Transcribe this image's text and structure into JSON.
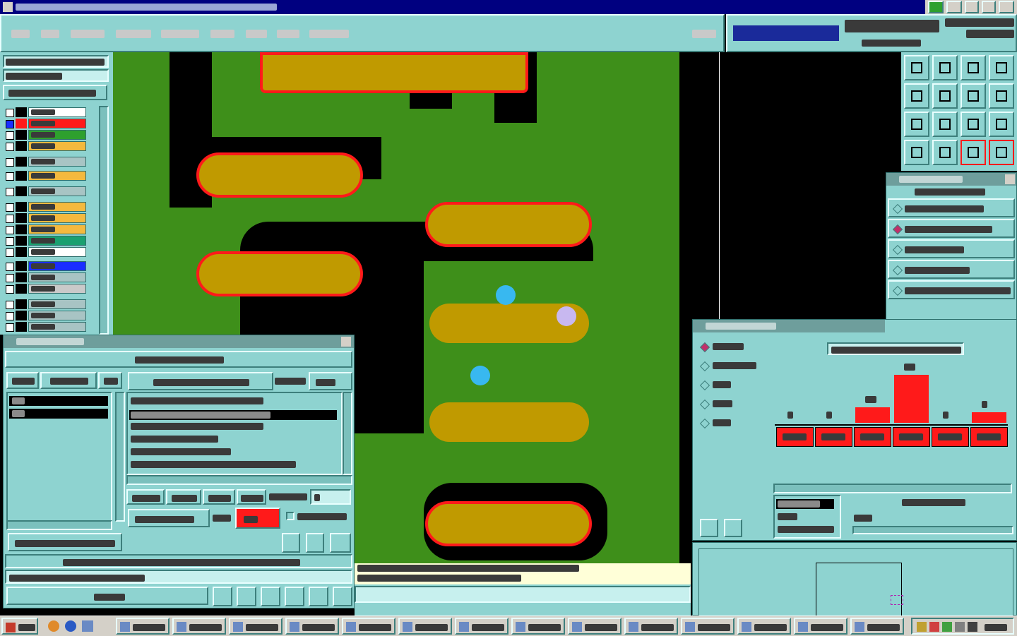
{
  "colors": {
    "window_bg": "#8ed3d0",
    "pcb_green": "#3e8f1a",
    "pad_gold": "#c09a00",
    "highlight_red": "#ff1a1a",
    "title_bar": "#000080",
    "taskbar": "#d4d0c8"
  },
  "icons": {
    "app": "editor-app-icon",
    "close": "close-x-icon",
    "toolbar": [
      "arrow-up-icon",
      "arrow-down-icon",
      "home-icon",
      "layout-icon",
      "arrow-left-icon",
      "arrow-right-icon",
      "swap-icon",
      "loop-icon",
      "zoom-fit-icon",
      "zoom-center-icon",
      "ratio-icon",
      "help-icon",
      "tools-icon",
      "grid-icon",
      "ruler-red-icon",
      "ruler-red2-icon"
    ]
  },
  "layers": {
    "colors": [
      "#ffffff",
      "#ff1a1a",
      "#2ea02e",
      "#f4b93e",
      "#a8c4c4",
      "#f4b93e",
      "#a8c4c4",
      "#f4b93e",
      "#f4b93e",
      "#f4b93e",
      "#1aa070",
      "#ffffff",
      "#1a2dff",
      "#a8c4c4",
      "#c9c9c9",
      "#a8c4c4",
      "#a8c4c4",
      "#a8c4c4"
    ],
    "selected": [
      false,
      true,
      false,
      false,
      false,
      false,
      false,
      false,
      false,
      false,
      false,
      false,
      false,
      false,
      false,
      false,
      false,
      false
    ]
  },
  "measure": {
    "selected_index": 1
  },
  "histogram": {
    "selected_index": 0,
    "counts_display": [
      1,
      1,
      10,
      31,
      1,
      7
    ],
    "bars": [
      0,
      0,
      10,
      31,
      0,
      7
    ],
    "bar_color": "#ff1a1a"
  },
  "taskbar": {
    "item_count": 14
  }
}
